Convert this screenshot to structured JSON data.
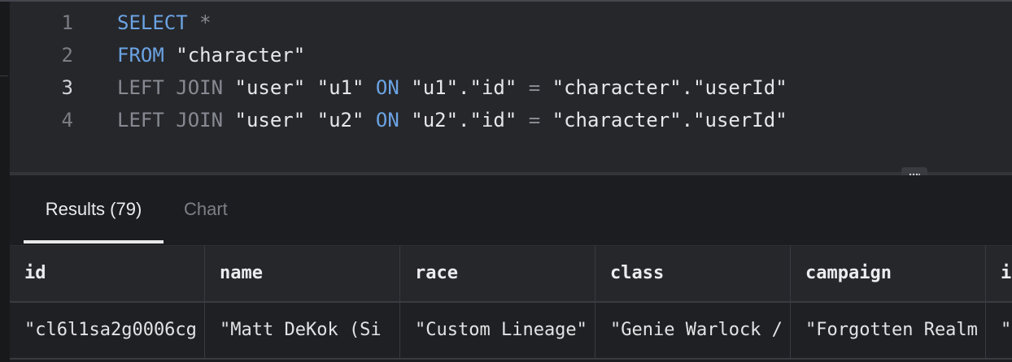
{
  "editor": {
    "lines": [
      {
        "number": "1",
        "tokens": [
          {
            "t": "SELECT",
            "c": "kw"
          },
          {
            "t": " ",
            "c": ""
          },
          {
            "t": "*",
            "c": "op"
          }
        ]
      },
      {
        "number": "2",
        "tokens": [
          {
            "t": "FROM",
            "c": "kw"
          },
          {
            "t": " \"character\"",
            "c": ""
          }
        ]
      },
      {
        "number": "3",
        "tokens": [
          {
            "t": "LEFT JOIN",
            "c": "kwd"
          },
          {
            "t": " \"user\" \"u1\" ",
            "c": ""
          },
          {
            "t": "ON",
            "c": "kw"
          },
          {
            "t": " \"u1\".\"id\" ",
            "c": ""
          },
          {
            "t": "=",
            "c": "op"
          },
          {
            "t": " \"character\".\"userId\"",
            "c": ""
          }
        ]
      },
      {
        "number": "4",
        "tokens": [
          {
            "t": "LEFT JOIN",
            "c": "kwd"
          },
          {
            "t": " \"user\" \"u2\" ",
            "c": ""
          },
          {
            "t": "ON",
            "c": "kw"
          },
          {
            "t": " \"u2\".\"id\" ",
            "c": ""
          },
          {
            "t": "=",
            "c": "op"
          },
          {
            "t": " \"character\".\"userId\"",
            "c": ""
          }
        ]
      }
    ],
    "active_line": "3"
  },
  "results": {
    "tabs": {
      "results_label": "Results (79)",
      "chart_label": "Chart"
    },
    "columns": [
      "id",
      "name",
      "race",
      "class",
      "campaign",
      "i"
    ],
    "rows": [
      [
        "\"cl6l1sa2g0006cg",
        "\"Matt DeKok (Si",
        "\"Custom Lineage\"",
        "\"Genie Warlock /",
        "\"Forgotten Realm",
        "\""
      ]
    ]
  },
  "icons": {
    "resize": "resize-handle-icon"
  }
}
